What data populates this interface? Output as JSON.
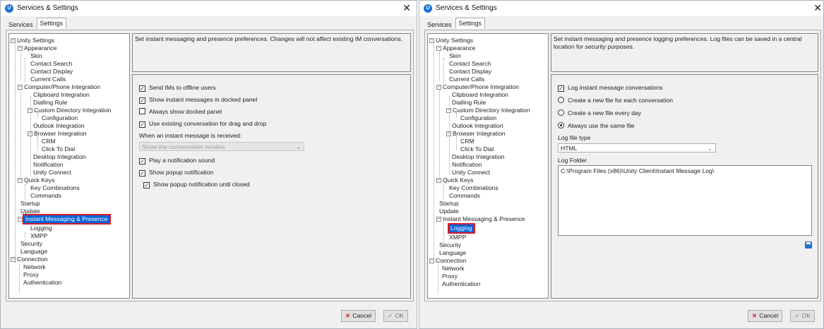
{
  "dialogs": [
    {
      "title": "Services & Settings",
      "tabs": [
        "Services",
        "Settings"
      ],
      "description": "Set instant messaging and presence preferences.  Changes will not affect existing IM conversations.",
      "options": {
        "send_offline": "Send IMs to offline users",
        "show_docked": "Show instant messages in docked panel",
        "always_docked": "Always show docked panel",
        "existing_conv": "Use existing conversation for drag and drop",
        "when_received": "When an instant message is received:",
        "received_select": "Show the conversation window",
        "play_sound": "Play a notification sound",
        "show_popup": "Show popup notification",
        "popup_until_closed": "Show popup notification until closed"
      },
      "buttons": {
        "cancel": "Cancel",
        "ok": "OK"
      }
    },
    {
      "title": "Services & Settings",
      "tabs": [
        "Services",
        "Settings"
      ],
      "description": "Set instant messaging and presence logging preferences.  Log files can be saved in a central location for security purposes.",
      "options": {
        "log_conversations": "Log instant message conversations",
        "new_file_each": "Create a new file for each conversation",
        "new_file_day": "Create a new file every day",
        "same_file": "Always use the same file",
        "file_type_label": "Log file type",
        "file_type_value": "HTML",
        "folder_label": "Log Folder",
        "folder_value": "C:\\Program Files (x86)\\Unity Client\\Instant Message Log\\"
      },
      "buttons": {
        "cancel": "Cancel",
        "ok": "OK"
      }
    }
  ],
  "tree": {
    "unity_settings": "Unity Settings",
    "appearance": "Appearance",
    "skin": "Skin",
    "contact_search": "Contact Search",
    "contact_display": "Contact Display",
    "current_calls": "Current Calls",
    "cpi": "Computer/Phone Integration",
    "clipboard": "Clipboard Integration",
    "dialling": "Dialling Rule",
    "custom_dir": "Custom Directory Integration",
    "configuration": "Configuration",
    "outlook": "Outlook Integration",
    "browser": "Browser Integration",
    "crm": "CRM",
    "click_to_dial": "Click To Dial",
    "desktop": "Desktop Integration",
    "notification": "Notification",
    "unity_connect": "Unity Connect",
    "quick_keys": "Quick Keys",
    "key_combinations": "Key Combinations",
    "commands": "Commands",
    "startup": "Startup",
    "update": "Update",
    "im_presence": "Instant Messaging & Presence",
    "logging": "Logging",
    "xmpp": "XMPP",
    "security": "Security",
    "language": "Language",
    "connection": "Connection",
    "network": "Network",
    "proxy": "Proxy",
    "authentication": "Authentication"
  }
}
